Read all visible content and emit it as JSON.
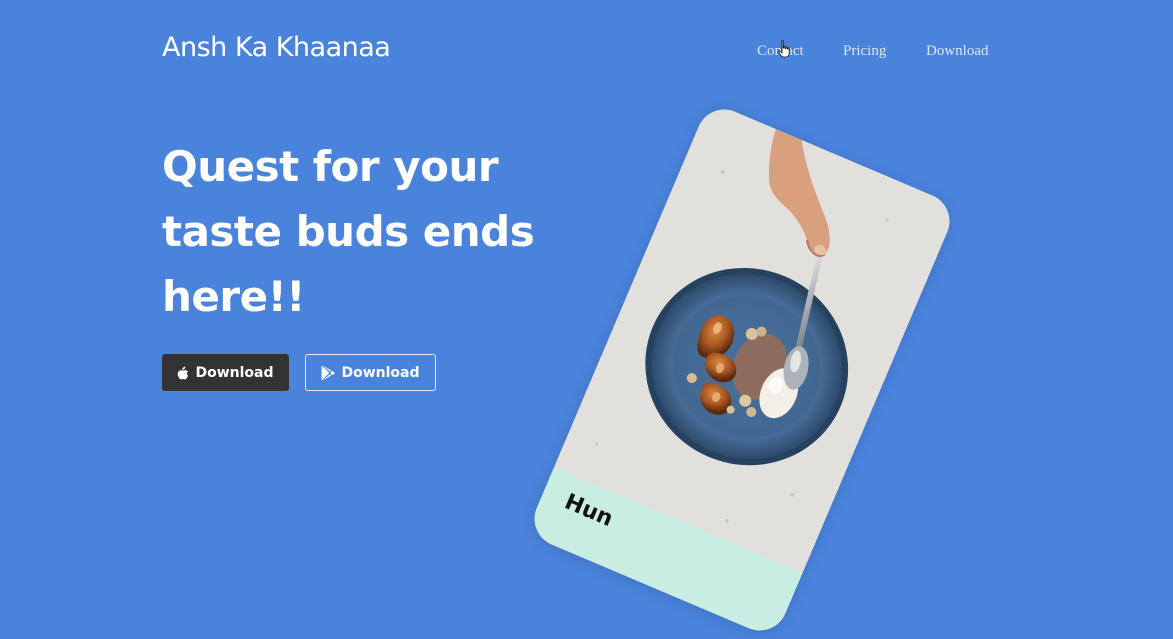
{
  "header": {
    "brand": "Ansh Ka Khaanaa",
    "nav": [
      {
        "label": "Contact"
      },
      {
        "label": "Pricing"
      },
      {
        "label": "Download"
      }
    ]
  },
  "hero": {
    "headline_lines": [
      "Quest for your",
      "taste buds ends",
      "here!!"
    ],
    "buttons": {
      "apple": {
        "label": "Download",
        "icon": "apple-icon"
      },
      "play": {
        "label": "Download",
        "icon": "play-store-icon"
      }
    }
  },
  "phone": {
    "footer_label": "Hun"
  },
  "colors": {
    "background": "#4a83dc",
    "apple_button": "#333336",
    "phone_footer": "#c8eee3"
  }
}
